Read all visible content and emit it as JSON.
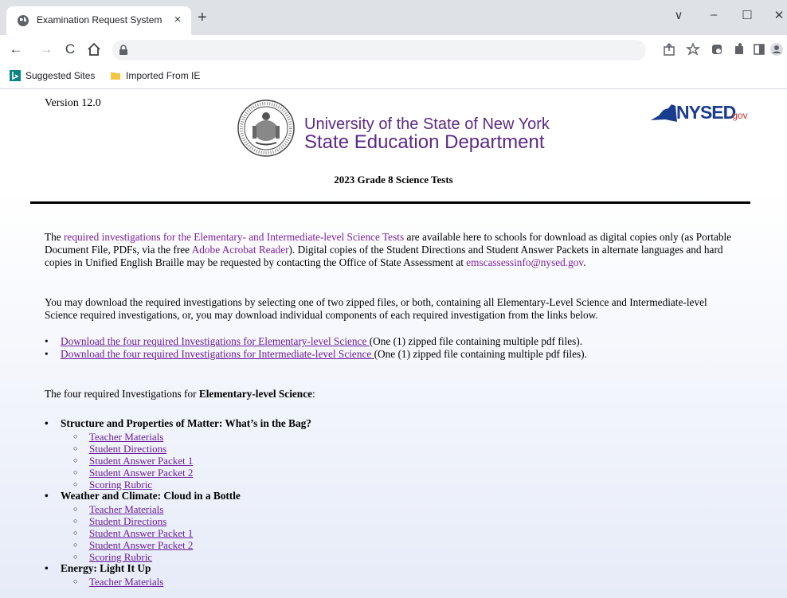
{
  "browser": {
    "tab_title": "Examination Request System",
    "tab_close": "×",
    "new_tab": "+",
    "address_value": "",
    "bookmarks": [
      "Suggested Sites",
      "Imported From IE"
    ],
    "window_controls": [
      "∨",
      "–",
      "☐",
      "✕"
    ]
  },
  "header": {
    "version": "Version 12.0",
    "line1": "University of the State of New York",
    "line2": "State Education Department",
    "logo_text": "NYSED",
    "logo_suffix": ".gov",
    "test_title": "2023 Grade 8 Science Tests"
  },
  "intro": {
    "p1_a": "The ",
    "p1_link": "required investigations for the Elementary- and Intermediate-level Science Tests",
    "p1_b": " are available here to schools for download as digital copies only (as Portable Document File, PDFs, via the free ",
    "p1_link2": "Adobe Acrobat Reader",
    "p1_c": "). Digital copies of the Student Directions and Student Answer Packets in alternate languages and hard copies in Unified English Braille may be requested by contacting the Office of State Assessment at ",
    "p1_email": "emscassessinfo@nysed.gov",
    "p1_d": ".",
    "p2": "You may download the required investigations by selecting one of two zipped files, or both, containing all Elementary-Level Science and Intermediate-level Science required investigations, or, you may download individual components of each required investigation from the links below.",
    "dl1_link": "Download the four required Investigations for Elementary-level Science ",
    "dl1_text": "(One (1) zipped file containing multiple pdf files).",
    "dl2_link": "Download the four required Investigations for Intermediate-level Science ",
    "dl2_text": "(One (1) zipped file containing multiple pdf files)."
  },
  "elementary": {
    "intro_a": "The four required Investigations for ",
    "intro_b": "Elementary-level Science",
    "intro_c": ":",
    "investigations": [
      {
        "title": "Structure and Properties of Matter: What’s in the Bag?",
        "items": [
          "Teacher Materials",
          "Student Directions",
          "Student Answer Packet 1",
          "Student Answer Packet 2",
          "Scoring Rubric"
        ]
      },
      {
        "title": "Weather and Climate: Cloud in a Bottle",
        "items": [
          "Teacher Materials",
          "Student Directions",
          "Student Answer Packet 1",
          "Student Answer Packet 2",
          "Scoring Rubric"
        ]
      },
      {
        "title": "Energy: Light It Up",
        "items": [
          "Teacher Materials"
        ]
      }
    ]
  },
  "colors": {
    "link": "#6a1b9a",
    "brand": "#5b2a86",
    "nysed_blue": "#1a3c8f",
    "nysed_red": "#d42e2e"
  }
}
